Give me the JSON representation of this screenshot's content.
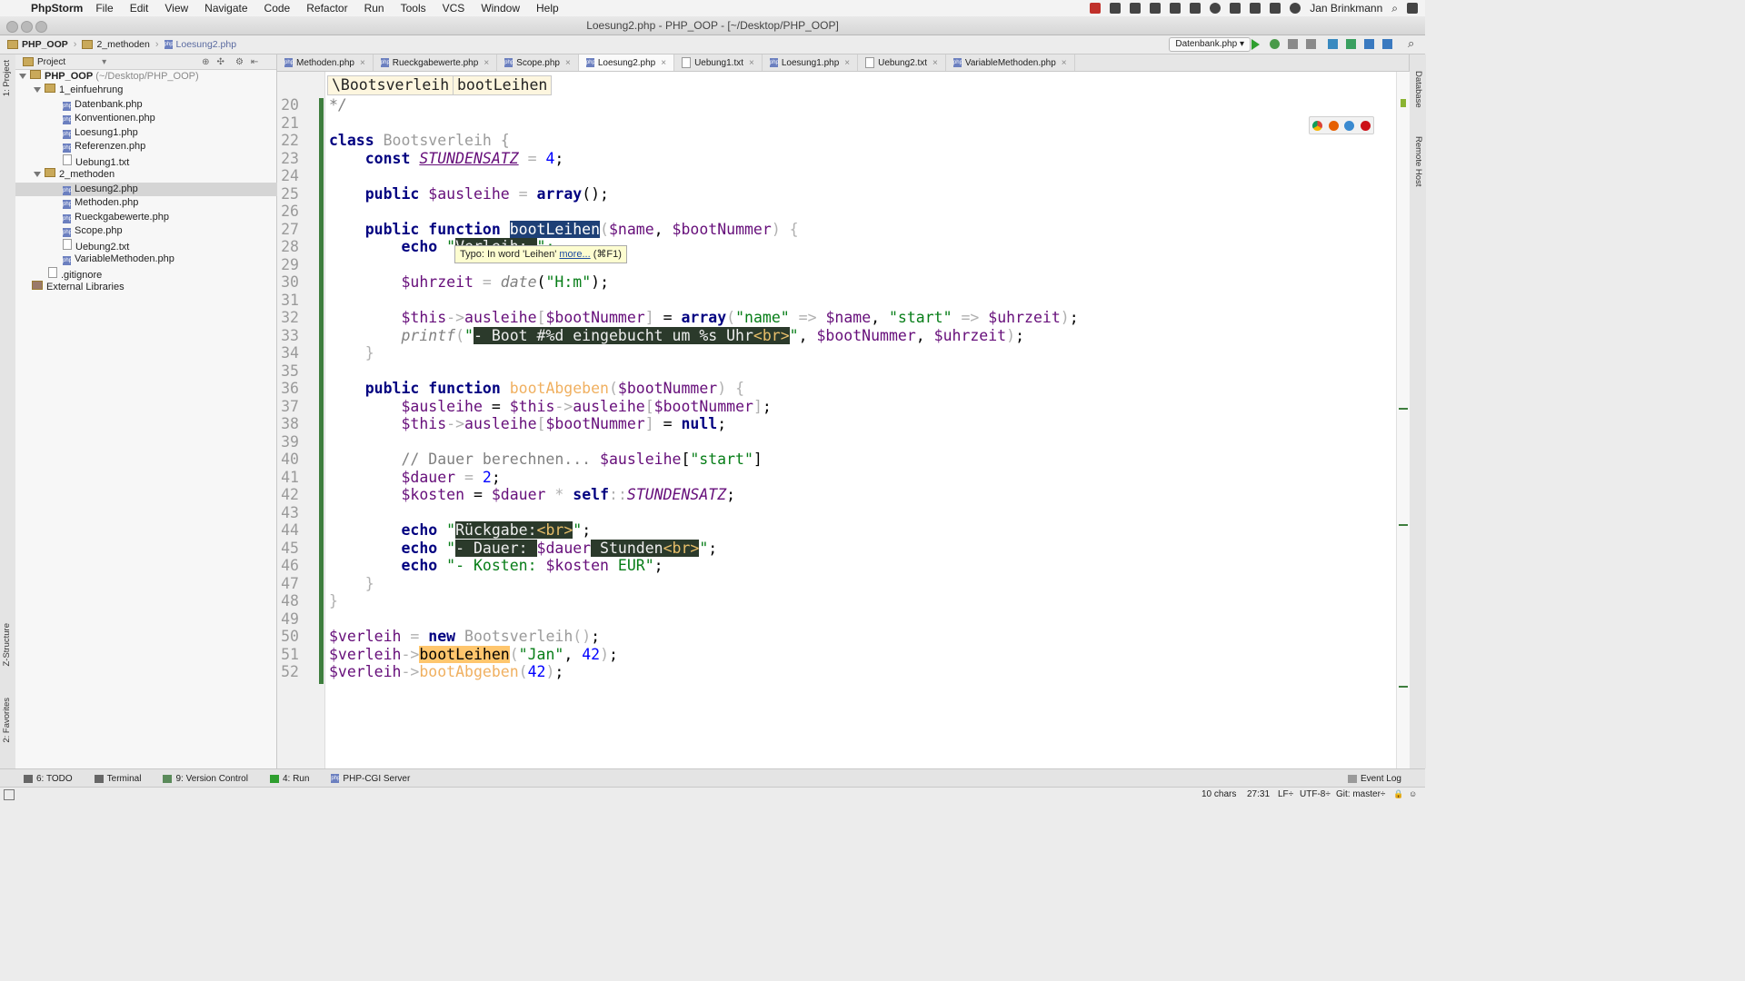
{
  "menubar": {
    "app_name": "PhpStorm",
    "items": [
      "File",
      "Edit",
      "View",
      "Navigate",
      "Code",
      "Refactor",
      "Run",
      "Tools",
      "VCS",
      "Window",
      "Help"
    ],
    "user": "Jan Brinkmann"
  },
  "window": {
    "title": "Loesung2.php - PHP_OOP - [~/Desktop/PHP_OOP]"
  },
  "navbar": {
    "breadcrumb": [
      "PHP_OOP",
      "2_methoden",
      "Loesung2.php"
    ],
    "run_config": "Datenbank.php"
  },
  "left_tabs": {
    "project": "1: Project",
    "structure": "Z-Structure",
    "favorites": "2: Favorites"
  },
  "right_tabs": {
    "database": "Database",
    "remote_host": "Remote Host"
  },
  "project": {
    "header": "Project",
    "root": "PHP_OOP",
    "root_path": "(~/Desktop/PHP_OOP)",
    "folders": {
      "f1": "1_einfuehrung",
      "f2": "2_methoden"
    },
    "f1_files": [
      "Datenbank.php",
      "Konventionen.php",
      "Loesung1.php",
      "Referenzen.php",
      "Uebung1.txt"
    ],
    "f2_files": [
      "Loesung2.php",
      "Methoden.php",
      "Rueckgabewerte.php",
      "Scope.php",
      "Uebung2.txt",
      "VariableMethoden.php"
    ],
    "gitignore": ".gitignore",
    "external": "External Libraries"
  },
  "tabs": [
    "Methoden.php",
    "Rueckgabewerte.php",
    "Scope.php",
    "Loesung2.php",
    "Uebung1.txt",
    "Loesung1.php",
    "Uebung2.txt",
    "VariableMethoden.php"
  ],
  "active_tab": "Loesung2.php",
  "editor": {
    "breadcrumb_class": "\\Bootsverleih",
    "breadcrumb_method": "bootLeihen",
    "tooltip_text": "Typo: In word 'Leihen'",
    "tooltip_link": "more...",
    "tooltip_shortcut": "(⌘F1)",
    "line_numbers": [
      "20",
      "21",
      "22",
      "23",
      "24",
      "25",
      "26",
      "27",
      "28",
      "29",
      "30",
      "31",
      "32",
      "33",
      "34",
      "35",
      "36",
      "37",
      "38",
      "39",
      "40",
      "41",
      "42",
      "43",
      "44",
      "45",
      "46",
      "47",
      "48",
      "49",
      "50",
      "51",
      "52"
    ]
  },
  "bottom_tools": {
    "todo": "6: TODO",
    "terminal": "Terminal",
    "vcs": "9: Version Control",
    "run": "4: Run",
    "php_cgi": "PHP-CGI Server",
    "event_log": "Event Log"
  },
  "status": {
    "chars": "10 chars",
    "position": "27:31",
    "line_sep": "LF÷",
    "encoding": "UTF-8÷",
    "git": "Git: master÷"
  },
  "colors": {
    "vcs_bar": "#3e7e3e",
    "selection": "#1e4076",
    "usage_highlight": "#ffc66d"
  }
}
